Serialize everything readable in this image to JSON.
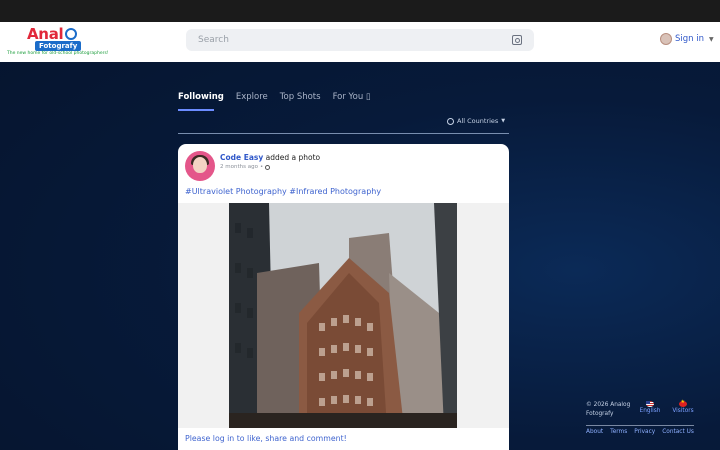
{
  "brand": {
    "logo_text_top": "Anal",
    "logo_text_mid": "Fotografy",
    "tagline": "The new home for old-school photographers!"
  },
  "header": {
    "search_placeholder": "Search",
    "signin_label": "Sign in"
  },
  "tabs": [
    {
      "label": "Following",
      "active": true
    },
    {
      "label": "Explore",
      "active": false
    },
    {
      "label": "Top Shots",
      "active": false
    },
    {
      "label": "For You",
      "active": false
    }
  ],
  "filter": {
    "countries_label": "All Countries"
  },
  "post": {
    "author": "Code Easy",
    "action": "added a photo",
    "time": "2 months ago",
    "hashtags": "#Ultraviolet Photography #Infrared Photography",
    "login_prompt": "Please log in to like, share and comment!"
  },
  "footer": {
    "copyright": "© 2026 Analog Fotografy",
    "language": "English",
    "visitors": "Visitors",
    "links": [
      "About",
      "Terms",
      "Privacy",
      "Contact Us"
    ]
  },
  "colors": {
    "accent": "#2f57c9",
    "brand_red": "#e1283a",
    "brand_blue": "#1b6cc9",
    "background": "#071a3a"
  },
  "icons": {
    "search_action": "scan-search-icon",
    "post_privacy": "globe-icon"
  }
}
